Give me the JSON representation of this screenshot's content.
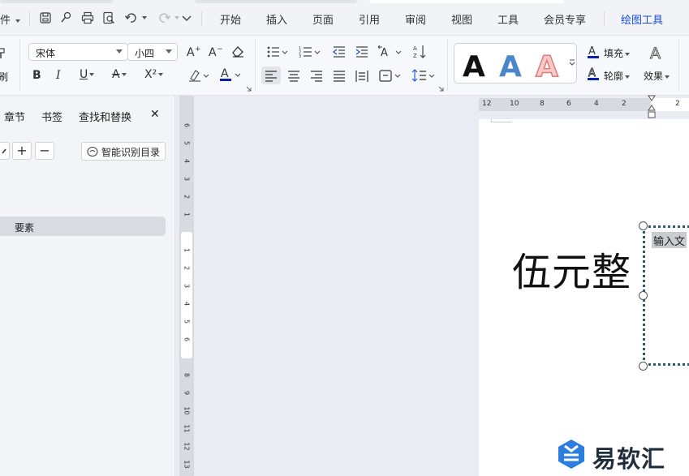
{
  "menubar": {
    "file_partial": "件",
    "tabs": [
      "开始",
      "插入",
      "页面",
      "引用",
      "审阅",
      "视图",
      "工具",
      "会员专享"
    ],
    "drawing_tools": "绘图工具"
  },
  "ribbon": {
    "format_painter_partial": "刷",
    "font_name": "宋体",
    "font_size": "小四",
    "fill_label": "填充",
    "outline_label": "轮廓",
    "effect_label": "效果",
    "bold": "B",
    "italic": "I",
    "underline": "U",
    "strike": "A",
    "superscript": "X²",
    "wordart_sample": "A"
  },
  "navpane": {
    "tabs": [
      "章节",
      "书签",
      "查找和替换"
    ],
    "close": "✕",
    "plus": "+",
    "minus": "−",
    "smart_toc": "智能识别目录",
    "selected_item": "要素"
  },
  "vruler": {
    "upper": [
      "6",
      "5",
      "4",
      "3",
      "2",
      "1"
    ],
    "lower": [
      "1",
      "2",
      "3",
      "4",
      "5",
      "6",
      "8",
      "9",
      "10",
      "11",
      "12",
      "13"
    ]
  },
  "hruler": {
    "numbers": [
      "12",
      "10",
      "8",
      "6",
      "4",
      "2",
      "2"
    ]
  },
  "document": {
    "big_text": "伍元整",
    "textbox_text": "输入文"
  },
  "watermark": {
    "text": "易软汇"
  },
  "colors": {
    "accent": "#1a4ed6",
    "font_color_bar": "#0b1fa8",
    "wordart_blue": "#4a86c8",
    "wordart_red": "#e07a7a"
  }
}
